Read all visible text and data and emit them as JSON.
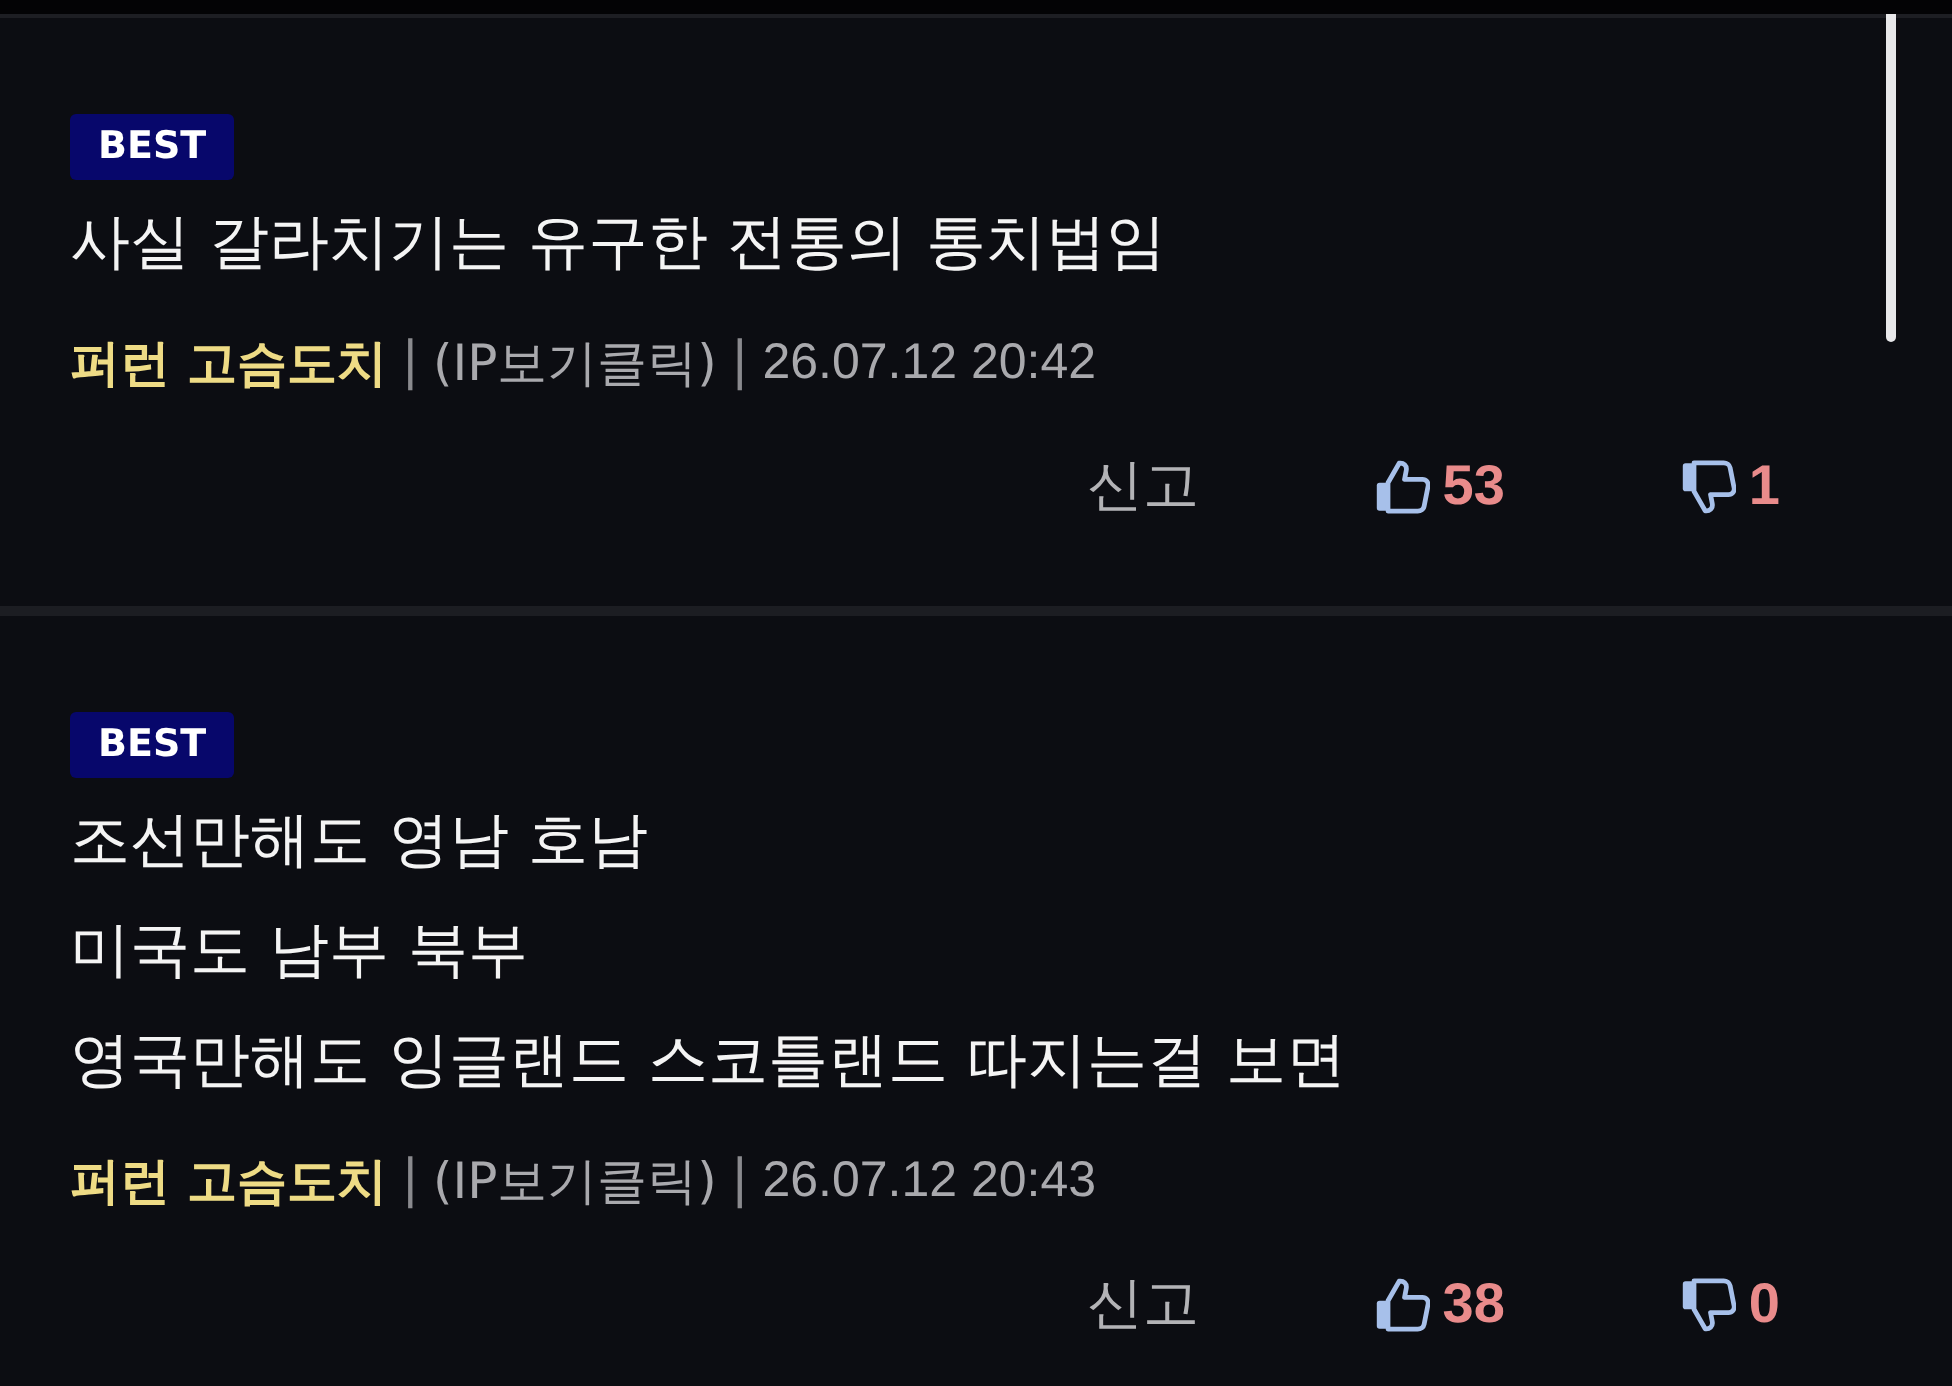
{
  "comments": [
    {
      "badge": "BEST",
      "text": "사실 갈라치기는 유구한 전통의 통치법임",
      "meta": [
        {
          "kind": "author",
          "text": "퍼런 고슴도치"
        },
        {
          "kind": "separator",
          "text": "|"
        },
        {
          "kind": "ip",
          "text": "(IP보기클릭)"
        },
        {
          "kind": "separator",
          "text": "|"
        },
        {
          "kind": "date",
          "text": "26.07.12 20:42"
        }
      ],
      "report": "신고",
      "likes": "53",
      "dislikes": "1"
    },
    {
      "badge": "BEST",
      "text": "조선만해도 영남 호남\n미국도 남부 북부\n영국만해도 잉글랜드 스코틀랜드 따지는걸 보면",
      "meta": [
        {
          "kind": "author",
          "text": "퍼런 고슴도치"
        },
        {
          "kind": "separator",
          "text": "|"
        },
        {
          "kind": "ip",
          "text": "(IP보기클릭)"
        },
        {
          "kind": "separator",
          "text": "|"
        },
        {
          "kind": "date",
          "text": "26.07.12 20:43"
        }
      ],
      "report": "신고",
      "likes": "38",
      "dislikes": "0"
    }
  ]
}
